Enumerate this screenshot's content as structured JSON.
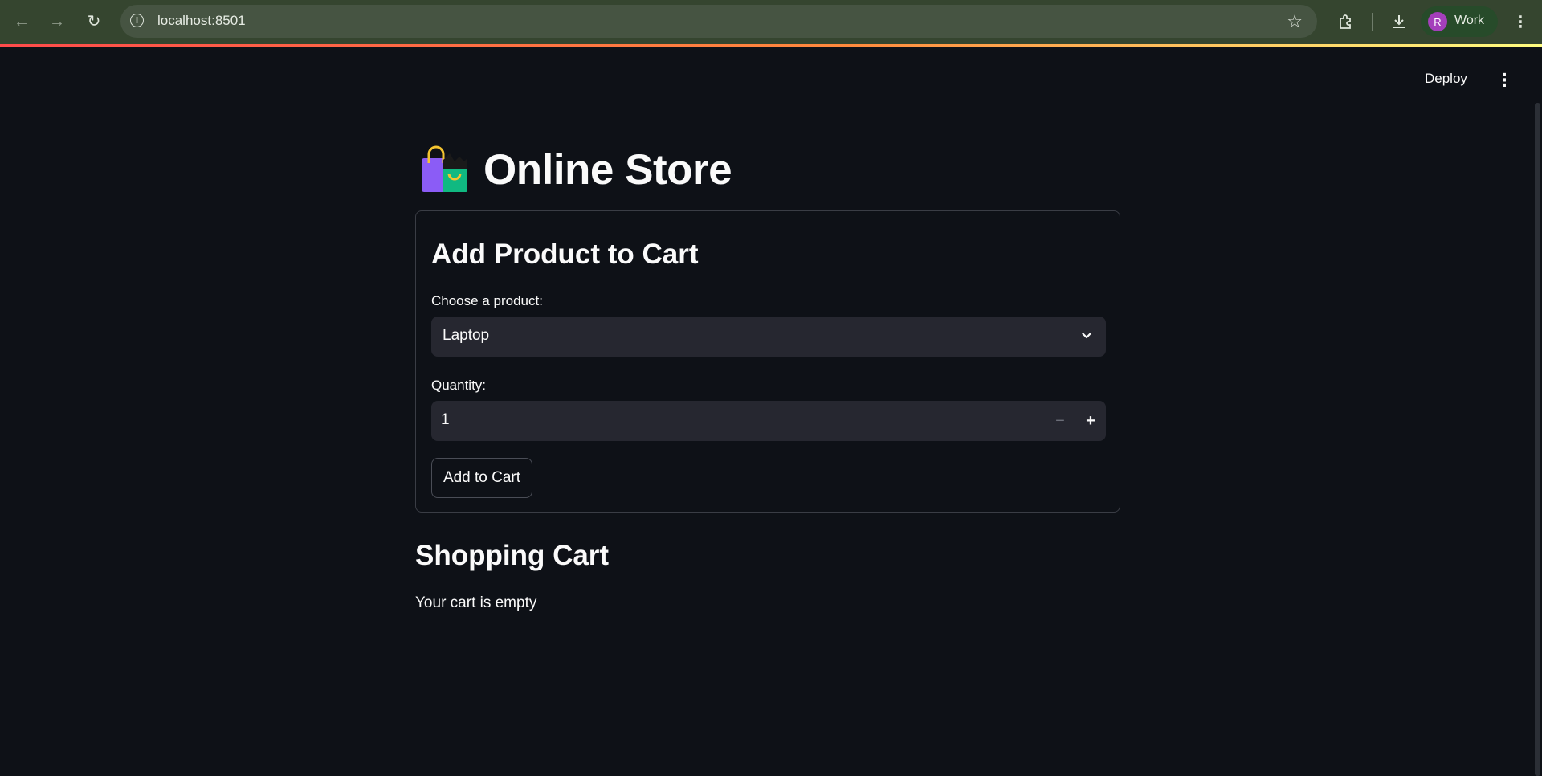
{
  "browser": {
    "url": "localhost:8501",
    "profile_initial": "R",
    "profile_label": "Work",
    "icons": {
      "back": "arrow-left-icon",
      "forward": "arrow-right-icon",
      "reload": "reload-icon",
      "site_info": "info-icon",
      "bookmark": "star-icon",
      "extensions": "puzzle-icon",
      "downloads": "download-icon",
      "menu": "kebab-menu-icon"
    }
  },
  "app_header": {
    "deploy_label": "Deploy",
    "menu_icon": "kebab-menu-icon"
  },
  "page": {
    "title_icon": "shopping-bags-icon",
    "title": "Online Store"
  },
  "add_form": {
    "heading": "Add Product to Cart",
    "product_label": "Choose a product:",
    "product_selected": "Laptop",
    "quantity_label": "Quantity:",
    "quantity_value": "1",
    "add_button_label": "Add to Cart"
  },
  "cart": {
    "heading": "Shopping Cart",
    "empty_message": "Your cart is empty"
  },
  "colors": {
    "background": "#0e1117",
    "input_background": "#262730",
    "text": "#fafafa",
    "chrome_toolbar": "#35452f",
    "profile_avatar": "#a43fbb"
  }
}
